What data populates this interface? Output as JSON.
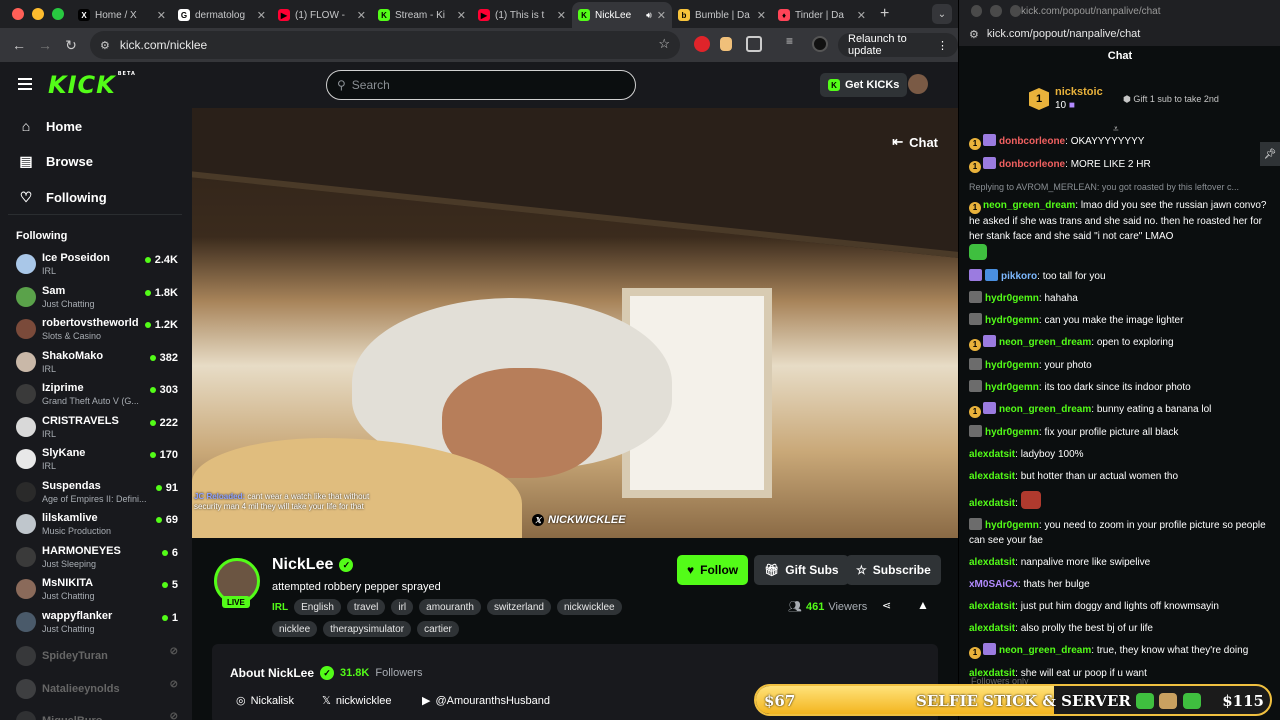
{
  "browser": {
    "tabs": [
      {
        "title": "Home / X",
        "fav": "X",
        "fav_color": "#000000"
      },
      {
        "title": "dermatolog",
        "fav": "G",
        "fav_color": "#ffffff"
      },
      {
        "title": "(1) FLOW -",
        "fav": "▶",
        "fav_color": "#ff0033"
      },
      {
        "title": "Stream - Ki",
        "fav": "K",
        "fav_color": "#53fc18"
      },
      {
        "title": "(1) This is t",
        "fav": "▶",
        "fav_color": "#ff0033"
      },
      {
        "title": "NickLee",
        "fav": "K",
        "fav_color": "#53fc18"
      },
      {
        "title": "Bumble | Da",
        "fav": "b",
        "fav_color": "#f7c33b"
      },
      {
        "title": "Tinder | Da",
        "fav": "♦",
        "fav_color": "#ff4458"
      }
    ],
    "url": "kick.com/nicklee",
    "relaunch_label": "Relaunch to update"
  },
  "kick": {
    "logo": "KICK",
    "logo_beta": "BETA",
    "search_placeholder": "Search",
    "get_kicks": "Get KICKs",
    "nav": [
      {
        "label": "Home",
        "icon": "home-icon"
      },
      {
        "label": "Browse",
        "icon": "browse-icon"
      },
      {
        "label": "Following",
        "icon": "heart-icon"
      }
    ],
    "following_header": "Following",
    "channels": [
      {
        "name": "Ice Poseidon",
        "category": "IRL",
        "viewers": "2.4K",
        "color": "#a9c7e8"
      },
      {
        "name": "Sam",
        "category": "Just Chatting",
        "viewers": "1.8K",
        "color": "#5aa24a"
      },
      {
        "name": "robertovstheworld",
        "category": "Slots & Casino",
        "viewers": "1.2K",
        "color": "#7a4a3a"
      },
      {
        "name": "ShakoMako",
        "category": "IRL",
        "viewers": "382",
        "color": "#c9b8a8"
      },
      {
        "name": "Iziprime",
        "category": "Grand Theft Auto V (G...",
        "viewers": "303",
        "color": "#3a3a3a"
      },
      {
        "name": "CRISTRAVELS",
        "category": "IRL",
        "viewers": "222",
        "color": "#d9d9d9"
      },
      {
        "name": "SlyKane",
        "category": "IRL",
        "viewers": "170",
        "color": "#e8e8e8"
      },
      {
        "name": "Suspendas",
        "category": "Age of Empires II: Defini...",
        "viewers": "91",
        "color": "#2a2a2a"
      },
      {
        "name": "lilskamlive",
        "category": "Music Production",
        "viewers": "69",
        "color": "#bfc6cc"
      },
      {
        "name": "HARMONEYES",
        "category": "Just Sleeping",
        "viewers": "6",
        "color": "#3a3a3a"
      },
      {
        "name": "MsNIKITA",
        "category": "Just Chatting",
        "viewers": "5",
        "color": "#8a6a5a"
      },
      {
        "name": "wappyflanker",
        "category": "Just Chatting",
        "viewers": "1",
        "color": "#4a5a6a"
      }
    ],
    "offline_channels": [
      {
        "name": "SpideyTuran",
        "color": "#666"
      },
      {
        "name": "Natalieeynolds",
        "color": "#777"
      },
      {
        "name": "MiguelBuro",
        "color": "#555"
      }
    ],
    "video": {
      "chat_toggle": "Chat",
      "caption_user": "JC Reloaded:",
      "caption_text": "cant wear a watch like that without security man 4 mil they will take your life for that",
      "watermark": "NICKWICKLEE"
    },
    "stream": {
      "channel": "NickLee",
      "live": "LIVE",
      "title": "attempted robbery pepper sprayed",
      "category": "IRL",
      "tags": [
        "English",
        "travel",
        "irl",
        "amouranth",
        "switzerland",
        "nickwicklee",
        "nicklee",
        "therapysimulator",
        "cartier"
      ],
      "follow": "Follow",
      "gift_subs": "Gift Subs",
      "subscribe": "Subscribe",
      "viewers": "461",
      "viewers_label": "Viewers"
    },
    "about": {
      "title": "About NickLee",
      "followers": "31.8K",
      "followers_label": "Followers",
      "socials": [
        {
          "icon": "instagram-icon",
          "label": "Nickalisk"
        },
        {
          "icon": "x-icon",
          "label": "nickwicklee"
        },
        {
          "icon": "youtube-icon",
          "label": "@AmouranthsHusband"
        }
      ]
    }
  },
  "chat": {
    "window_title": "kick.com/popout/nanpalive/chat",
    "url": "kick.com/popout/nanpalive/chat",
    "header": "Chat",
    "pinned": {
      "user": "nickstoic",
      "count": "10",
      "gift_text": "Gift 1 sub to take 2nd"
    },
    "reply_context": "Replying to AVROM_MERLEAN: you got roasted by this leftover c...",
    "followers_only": "Followers only",
    "messages": [
      {
        "user": "donbcorleone",
        "color": "#f06060",
        "text": "OKAYYYYYYYY",
        "badges": "12"
      },
      {
        "user": "donbcorleone",
        "color": "#f06060",
        "text": "MORE LIKE 2 HR",
        "badges": "12"
      },
      {
        "user": "neon_green_dream",
        "color": "#53fc18",
        "text": "lmao did you see the russian jawn convo? he asked if she was trans and she said no. then he roasted her for her stank face and she said \"i not care\" LMAO",
        "badges": "1",
        "emote": "g"
      },
      {
        "user": "pikkoro",
        "color": "#7db9ff",
        "text": "too tall for you",
        "badges": "42"
      },
      {
        "user": "hydr0gemn",
        "color": "#53fc18",
        "text": "hahaha",
        "badges": "3"
      },
      {
        "user": "hydr0gemn",
        "color": "#53fc18",
        "text": "can you make the image lighter",
        "badges": "3"
      },
      {
        "user": "neon_green_dream",
        "color": "#53fc18",
        "text": "open to exploring",
        "badges": "12"
      },
      {
        "user": "hydr0gemn",
        "color": "#53fc18",
        "text": "your photo",
        "badges": "3"
      },
      {
        "user": "hydr0gemn",
        "color": "#53fc18",
        "text": "its too dark since its indoor photo",
        "badges": "3"
      },
      {
        "user": "neon_green_dream",
        "color": "#53fc18",
        "text": "bunny eating a banana lol",
        "badges": "12"
      },
      {
        "user": "hydr0gemn",
        "color": "#53fc18",
        "text": "fix your profile picture all black",
        "badges": "3"
      },
      {
        "user": "alexdatsit",
        "color": "#53fc18",
        "text": "ladyboy 100%",
        "badges": ""
      },
      {
        "user": "alexdatsit",
        "color": "#53fc18",
        "text": "but hotter than ur actual women tho",
        "badges": ""
      },
      {
        "user": "alexdatsit",
        "color": "#53fc18",
        "text": "",
        "badges": "",
        "emote": "r"
      },
      {
        "user": "hydr0gemn",
        "color": "#53fc18",
        "text": "you need to zoom in your profile picture so people can see your fae",
        "badges": "3"
      },
      {
        "user": "alexdatsit",
        "color": "#53fc18",
        "text": "nanpalive more like swipelive",
        "badges": ""
      },
      {
        "user": "xM0SAiCx",
        "color": "#b38bff",
        "text": "thats her bulge",
        "badges": ""
      },
      {
        "user": "alexdatsit",
        "color": "#53fc18",
        "text": "just put him doggy and lights off knowmsayin",
        "badges": ""
      },
      {
        "user": "alexdatsit",
        "color": "#53fc18",
        "text": "also prolly the best bj of ur life",
        "badges": ""
      },
      {
        "user": "neon_green_dream",
        "color": "#53fc18",
        "text": "true, they know what they're doing",
        "badges": "12"
      },
      {
        "user": "alexdatsit",
        "color": "#53fc18",
        "text": "she will eat ur poop if u want",
        "badges": ""
      }
    ]
  },
  "goal": {
    "current": "$67",
    "label": "SELFIE STICK & SERVER",
    "target": "$115",
    "progress": 0.58
  }
}
